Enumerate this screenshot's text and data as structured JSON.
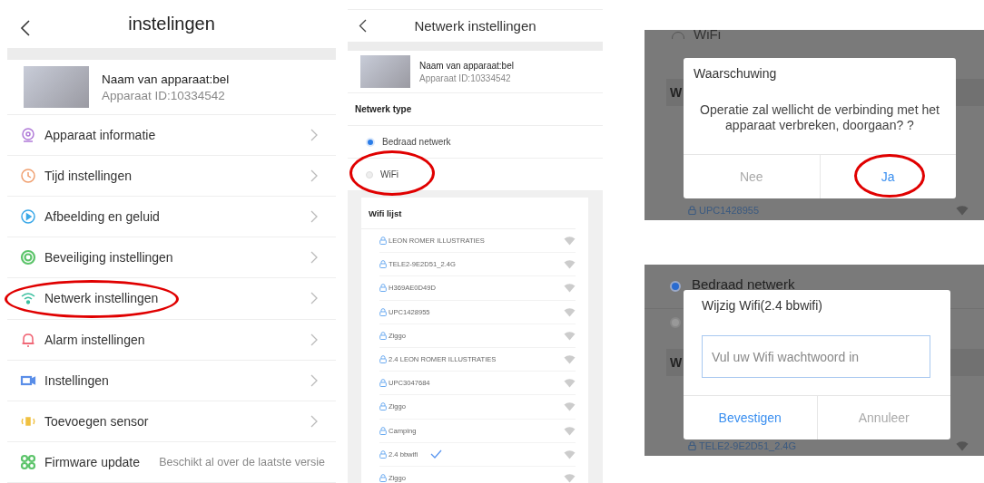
{
  "settings_screen": {
    "title": "instelingen",
    "device": {
      "name": "Naam van apparaat:bel",
      "id": "Apparaat ID:10334542"
    },
    "items": [
      {
        "label": "Apparaat informatie",
        "kind": "camera",
        "color": "#b07ad8",
        "circled": false
      },
      {
        "label": "Tijd instellingen",
        "kind": "clock",
        "color": "#f0a070",
        "circled": false
      },
      {
        "label": "Afbeelding en geluid",
        "kind": "play",
        "color": "#3aa8e8",
        "circled": false
      },
      {
        "label": "Beveiliging instellingen",
        "kind": "shield",
        "color": "#5cc46a",
        "circled": false
      },
      {
        "label": "Netwerk instellingen",
        "kind": "wifi",
        "color": "#3cc0a0",
        "circled": true
      },
      {
        "label": "Alarm instellingen",
        "kind": "bell",
        "color": "#f06070",
        "circled": false
      },
      {
        "label": "Instellingen",
        "kind": "video",
        "color": "#5a8ee8",
        "circled": false
      },
      {
        "label": "Toevoegen sensor",
        "kind": "sensor",
        "color": "#f0c040",
        "circled": false
      },
      {
        "label": "Firmware update",
        "kind": "firmware",
        "color": "#5cc46a",
        "value": "Beschikt al over de laatste versie",
        "circled": false
      }
    ]
  },
  "network_screen": {
    "title": "Netwerk instellingen",
    "device": {
      "name": "Naam van apparaat:bel",
      "id": "Apparaat ID:10334542"
    },
    "section": "Netwerk type",
    "options": [
      {
        "label": "Bedraad netwerk",
        "selected": true,
        "circled": false
      },
      {
        "label": "WiFi",
        "selected": false,
        "circled": true
      }
    ],
    "wifi_list": {
      "title": "Wifi lijst",
      "networks": [
        {
          "name": "LEON ROMER ILLUSTRATIES",
          "selected": false
        },
        {
          "name": "TELE2-9E2D51_2.4G",
          "selected": false
        },
        {
          "name": "H369AE0D49D",
          "selected": false
        },
        {
          "name": "UPC1428955",
          "selected": false
        },
        {
          "name": "Ziggo",
          "selected": false
        },
        {
          "name": "2.4 LEON ROMER ILLUSTRATIES",
          "selected": false
        },
        {
          "name": "UPC3047684",
          "selected": false
        },
        {
          "name": "Ziggo",
          "selected": false
        },
        {
          "name": "Camping",
          "selected": false
        },
        {
          "name": "2.4 bbwifi",
          "selected": true
        },
        {
          "name": "Ziggo",
          "selected": false
        }
      ]
    }
  },
  "warning_dialog": {
    "background": {
      "option": {
        "label": "WiFi",
        "selected": false
      },
      "section_initial": "W",
      "network": "UPC1428955"
    },
    "title": "Waarschuwing",
    "message": "Operatie zal wellicht de verbinding met het apparaat verbreken, doorgaan? ?",
    "buttons": [
      {
        "label": "Nee",
        "kind": "cancel",
        "circled": false
      },
      {
        "label": "Ja",
        "kind": "confirm",
        "circled": true
      }
    ]
  },
  "wifi_dialog": {
    "background": {
      "options": [
        {
          "label": "Bedraad netwerk",
          "selected": true
        },
        {
          "selected": false
        }
      ],
      "section_initial": "W",
      "network": "TELE2-9E2D51_2.4G"
    },
    "title": "Wijzig Wifi(2.4 bbwifi)",
    "placeholder": "Vul uw Wifi wachtwoord in",
    "buttons": [
      {
        "label": "Bevestigen",
        "kind": "confirm",
        "circled": false
      },
      {
        "label": "Annuleer",
        "kind": "cancel",
        "circled": false
      }
    ]
  }
}
